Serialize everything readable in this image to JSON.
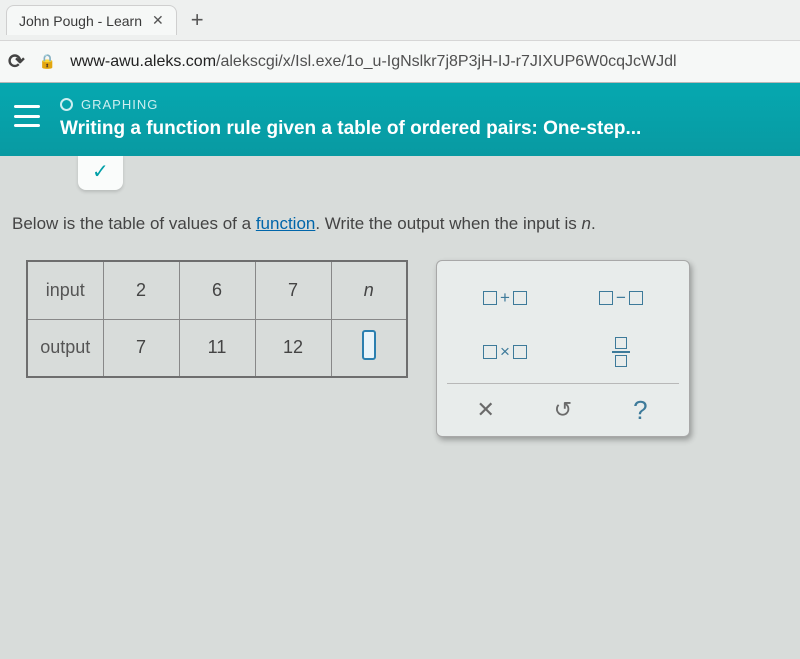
{
  "browser": {
    "tab_title": "John Pough - Learn",
    "url_host": "www-awu.aleks.com",
    "url_path": "/alekscgi/x/Isl.exe/1o_u-IgNslkr7j8P3jH-IJ-r7JIXUP6W0cqJcWJdl"
  },
  "header": {
    "section": "GRAPHING",
    "topic": "Writing a function rule given a table of ordered pairs: One-step...",
    "check_glyph": "✓"
  },
  "prompt": {
    "pre": "Below is the table of values of a ",
    "link": "function",
    "post": ". Write the output when the input is ",
    "var": "n",
    "end": "."
  },
  "table": {
    "row1_label": "input",
    "row2_label": "output",
    "cols": [
      {
        "input": "2",
        "output": "7"
      },
      {
        "input": "6",
        "output": "11"
      },
      {
        "input": "7",
        "output": "12"
      }
    ],
    "var_col_input": "n"
  },
  "keypad": {
    "plus": "+",
    "minus": "−",
    "times": "×",
    "clear": "✕",
    "reset": "↺",
    "help": "?"
  }
}
